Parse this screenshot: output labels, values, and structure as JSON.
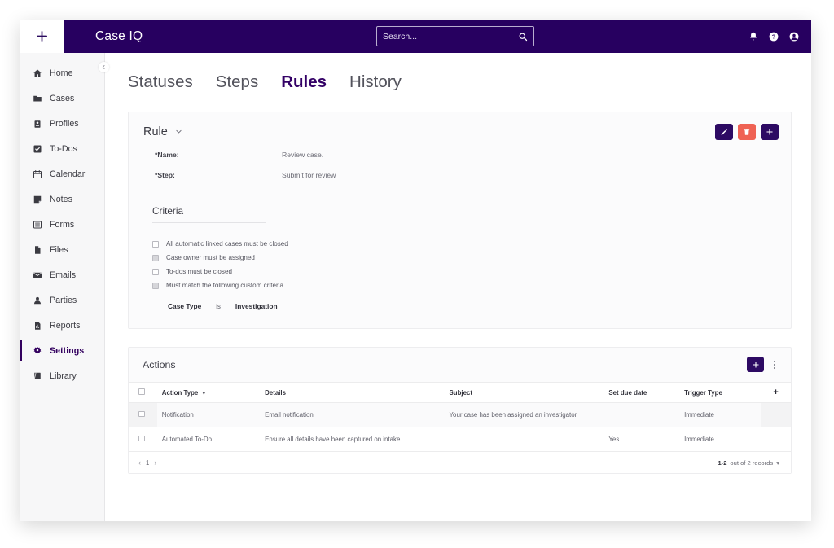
{
  "colors": {
    "brand_purple": "#270060",
    "accent_purple": "#2d0a63",
    "danger_red": "#ef6254",
    "page_bg": "#ffffff",
    "sidebar_bg": "#f7f7f8",
    "card_bg": "#fbfbfc"
  },
  "topbar": {
    "new_button_icon": "plus-icon",
    "brand": "Case IQ",
    "search": {
      "placeholder": "Search...",
      "value": "",
      "icon": "search-icon"
    },
    "icons": [
      {
        "name": "notifications-bell-icon"
      },
      {
        "name": "help-circle-icon"
      },
      {
        "name": "account-circle-icon"
      }
    ]
  },
  "sidebar": {
    "collapse_icon": "chevron-left-icon",
    "items": [
      {
        "label": "Home",
        "icon": "home-icon",
        "active": false
      },
      {
        "label": "Cases",
        "icon": "folder-icon",
        "active": false
      },
      {
        "label": "Profiles",
        "icon": "id-card-icon",
        "active": false
      },
      {
        "label": "To-Dos",
        "icon": "check-square-icon",
        "active": false
      },
      {
        "label": "Calendar",
        "icon": "calendar-icon",
        "active": false
      },
      {
        "label": "Notes",
        "icon": "note-icon",
        "active": false
      },
      {
        "label": "Forms",
        "icon": "list-icon",
        "active": false
      },
      {
        "label": "Files",
        "icon": "file-icon",
        "active": false
      },
      {
        "label": "Emails",
        "icon": "envelope-icon",
        "active": false
      },
      {
        "label": "Parties",
        "icon": "person-icon",
        "active": false
      },
      {
        "label": "Reports",
        "icon": "report-icon",
        "active": false
      },
      {
        "label": "Settings",
        "icon": "gear-icon",
        "active": true
      },
      {
        "label": "Library",
        "icon": "book-icon",
        "active": false
      }
    ]
  },
  "tabs": [
    {
      "label": "Statuses",
      "active": false
    },
    {
      "label": "Steps",
      "active": false
    },
    {
      "label": "Rules",
      "active": true
    },
    {
      "label": "History",
      "active": false
    }
  ],
  "rule_card": {
    "title": "Rule",
    "collapse_icon": "chevron-down-icon",
    "buttons": [
      {
        "name": "edit-button",
        "icon": "pencil-icon",
        "style": "purple"
      },
      {
        "name": "delete-button",
        "icon": "trash-icon",
        "style": "red"
      },
      {
        "name": "add-button",
        "icon": "plus-icon",
        "style": "purple"
      }
    ],
    "fields": [
      {
        "label": "*Name:",
        "value": "Review case."
      },
      {
        "label": "*Step:",
        "value": "Submit for review"
      }
    ],
    "criteria": {
      "title": "Criteria",
      "checkboxes": [
        {
          "label": "All automatic linked cases must be closed",
          "checked": false
        },
        {
          "label": "Case owner must be assigned",
          "checked": true
        },
        {
          "label": "To-dos must be closed",
          "checked": false
        },
        {
          "label": "Must match the following custom criteria",
          "checked": true
        }
      ],
      "custom": {
        "field": "Case Type",
        "operator": "is",
        "value": "Investigation"
      }
    }
  },
  "actions_card": {
    "title": "Actions",
    "add_button_icon": "plus-icon",
    "menu_icon": "kebab-menu-icon",
    "columns": [
      {
        "key": "check",
        "label": "",
        "sort": false
      },
      {
        "key": "type",
        "label": "Action Type",
        "sort": true
      },
      {
        "key": "details",
        "label": "Details",
        "sort": false
      },
      {
        "key": "subject",
        "label": "Subject",
        "sort": false
      },
      {
        "key": "due",
        "label": "Set due date",
        "sort": false
      },
      {
        "key": "trigger",
        "label": "Trigger Type",
        "sort": false
      },
      {
        "key": "plus",
        "label": "+",
        "sort": false
      }
    ],
    "rows": [
      {
        "type": "Notification",
        "details": "Email notification",
        "subject": "Your case has been assigned an investigator",
        "due": "",
        "trigger": "Immediate"
      },
      {
        "type": "Automated To-Do",
        "details": "Ensure all details have been captured on intake.",
        "subject": "",
        "due": "Yes",
        "trigger": "Immediate"
      }
    ],
    "pager": {
      "prev_icon": "chevron-left-icon",
      "next_icon": "chevron-right-icon",
      "page": "1",
      "records_prefix": "1-2",
      "records_suffix": "out of 2 records",
      "records_caret": "▾"
    }
  }
}
